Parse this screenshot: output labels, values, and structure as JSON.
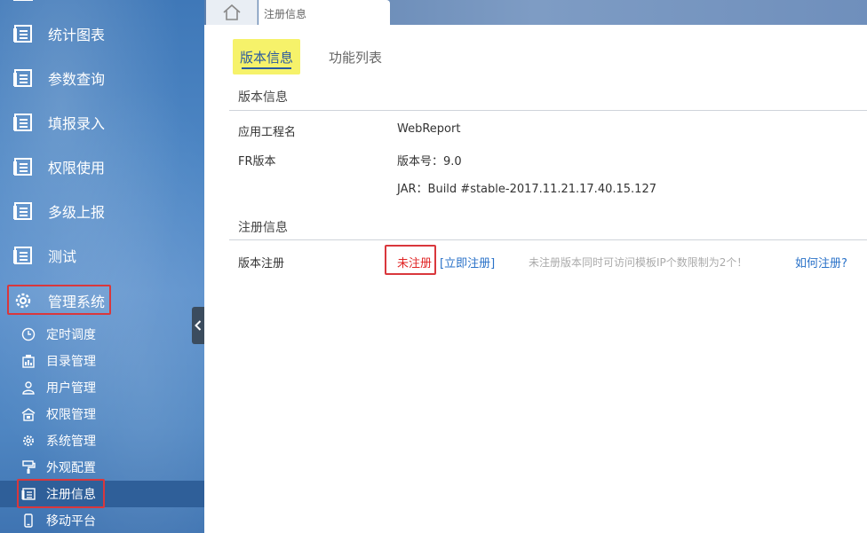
{
  "sidebar": {
    "items": [
      {
        "label": "统计图表",
        "icon": "report-icon"
      },
      {
        "label": "参数查询",
        "icon": "report-icon"
      },
      {
        "label": "填报录入",
        "icon": "report-icon"
      },
      {
        "label": "权限使用",
        "icon": "report-icon"
      },
      {
        "label": "多级上报",
        "icon": "report-icon"
      },
      {
        "label": "测试",
        "icon": "report-icon"
      },
      {
        "label": "管理系统",
        "icon": "gear-icon"
      }
    ],
    "subitems": [
      {
        "label": "定时调度",
        "icon": "clock-icon"
      },
      {
        "label": "目录管理",
        "icon": "catalog-icon"
      },
      {
        "label": "用户管理",
        "icon": "user-icon"
      },
      {
        "label": "权限管理",
        "icon": "lock-icon"
      },
      {
        "label": "系统管理",
        "icon": "gear-icon"
      },
      {
        "label": "外观配置",
        "icon": "paint-roller-icon"
      },
      {
        "label": "注册信息",
        "icon": "register-icon"
      },
      {
        "label": "移动平台",
        "icon": "mobile-icon"
      }
    ]
  },
  "tabs": {
    "home_icon": "home-icon",
    "page_tab_label": "注册信息"
  },
  "content": {
    "tab_version": "版本信息",
    "tab_functions": "功能列表",
    "version_section": "版本信息",
    "app_project_label": "应用工程名",
    "app_project_value": "WebReport",
    "fr_version_label": "FR版本",
    "fr_version_value": "版本号：9.0",
    "jar_value": "JAR：Build #stable-2017.11.21.17.40.15.127",
    "register_section": "注册信息",
    "version_register_label": "版本注册",
    "unregistered": "未注册",
    "register_now": "[立即注册]",
    "limit_note": "未注册版本同时可访问模板IP个数限制为2个！",
    "how_to_register": "如何注册?"
  },
  "colors": {
    "highlight_box": "#d9373c",
    "tab_highlight": "#f6f26a",
    "link": "#2a72c8",
    "unregistered": "#e02424",
    "sidebar_selected": "#2f5f99"
  }
}
